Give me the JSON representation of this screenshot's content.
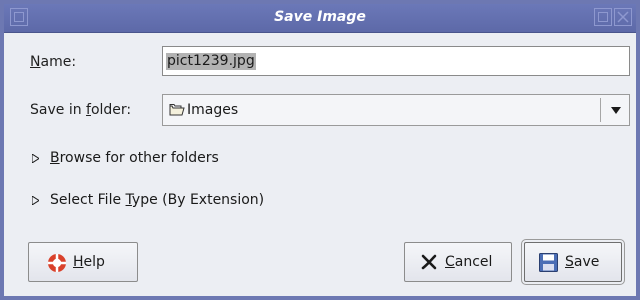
{
  "window": {
    "title": "Save Image"
  },
  "form": {
    "name_label": "Name:",
    "name_value": "pict1239.jpg",
    "folder_label_pre": "Save in ",
    "folder_label_u": "f",
    "folder_label_post": "older:",
    "folder_value": "Images"
  },
  "expanders": {
    "browse_u": "B",
    "browse_rest": "rowse for other folders",
    "filetype_pre": "Select File ",
    "filetype_u": "T",
    "filetype_post": "ype (By Extension)"
  },
  "buttons": {
    "help_u": "H",
    "help_rest": "elp",
    "cancel_u": "C",
    "cancel_rest": "ancel",
    "save_u": "S",
    "save_rest": "ave"
  },
  "colors": {
    "titlebar": "#6b78b8",
    "dialog_bg": "#eceef3",
    "help_icon": "#d9412b",
    "cancel_icon": "#1a1a1a",
    "save_icon": "#4a6db5"
  }
}
